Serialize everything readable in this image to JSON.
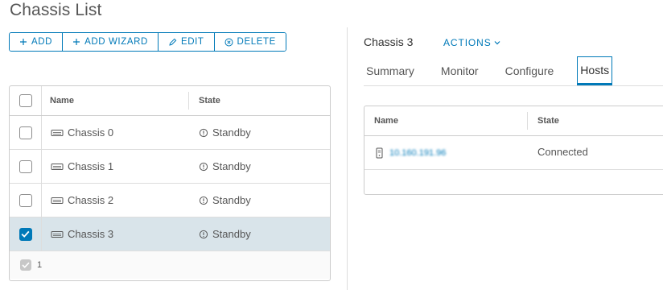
{
  "page": {
    "title": "Chassis List"
  },
  "toolbar": {
    "add": "ADD",
    "add_wizard": "ADD WIZARD",
    "edit": "EDIT",
    "delete": "DELETE"
  },
  "chassis_grid": {
    "columns": {
      "name": "Name",
      "state": "State"
    },
    "rows": [
      {
        "name": "Chassis 0",
        "state": "Standby",
        "selected": false
      },
      {
        "name": "Chassis 1",
        "state": "Standby",
        "selected": false
      },
      {
        "name": "Chassis 2",
        "state": "Standby",
        "selected": false
      },
      {
        "name": "Chassis 3",
        "state": "Standby",
        "selected": true
      }
    ],
    "footer": {
      "selected_count": "1"
    }
  },
  "detail": {
    "title": "Chassis 3",
    "actions_label": "ACTIONS",
    "tabs": [
      {
        "label": "Summary",
        "active": false
      },
      {
        "label": "Monitor",
        "active": false
      },
      {
        "label": "Configure",
        "active": false
      },
      {
        "label": "Hosts",
        "active": true
      }
    ],
    "hosts_grid": {
      "columns": {
        "name": "Name",
        "state": "State"
      },
      "rows": [
        {
          "name": "10.160.191.96",
          "state": "Connected"
        }
      ]
    }
  },
  "colors": {
    "accent": "#0079b8",
    "selected_row": "#d9e4ea",
    "border": "#cccccc"
  },
  "icons": {
    "add": "plus-icon",
    "edit": "pencil-icon",
    "delete": "circle-x-icon",
    "chassis": "server-chassis-icon",
    "state": "standby-icon",
    "host": "host-icon",
    "actions": "chevron-down-icon"
  }
}
